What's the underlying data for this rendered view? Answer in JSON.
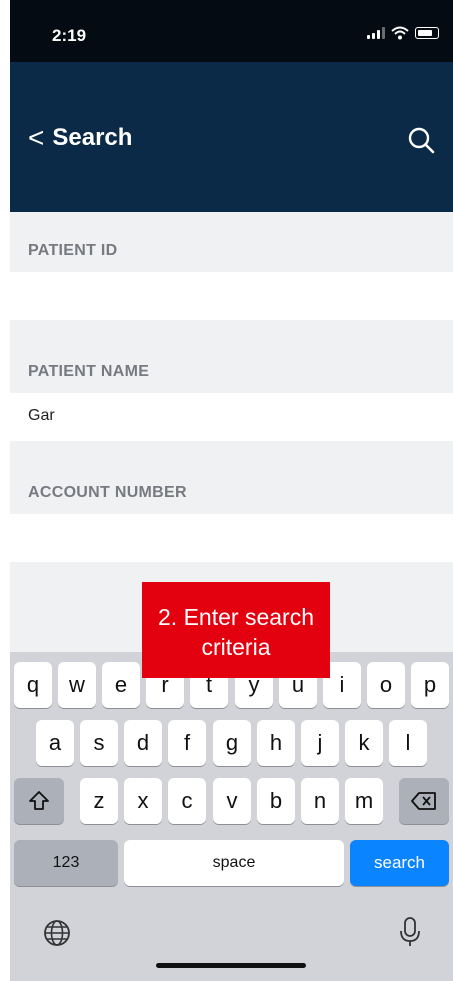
{
  "status_bar": {
    "time": "2:19"
  },
  "nav": {
    "back_label": "Search",
    "back_chevron": "<"
  },
  "form": {
    "patient_id": {
      "label": "PATIENT ID",
      "value": ""
    },
    "patient_name": {
      "label": "PATIENT NAME",
      "value": "Gar"
    },
    "account_number": {
      "label": "ACCOUNT NUMBER",
      "value": ""
    }
  },
  "hint": {
    "line1": "2. Enter search",
    "line2": "criteria"
  },
  "keyboard": {
    "row1": [
      "q",
      "w",
      "e",
      "r",
      "t",
      "y",
      "u",
      "i",
      "o",
      "p"
    ],
    "row2": [
      "a",
      "s",
      "d",
      "f",
      "g",
      "h",
      "j",
      "k",
      "l"
    ],
    "row3": [
      "z",
      "x",
      "c",
      "v",
      "b",
      "n",
      "m"
    ],
    "numbers_label": "123",
    "space_label": "space",
    "search_label": "search"
  },
  "colors": {
    "nav": "#0b2a47",
    "hint": "#e3000f",
    "search_key": "#0a84ff"
  },
  "icons": [
    "signal-icon",
    "wifi-icon",
    "battery-icon",
    "back-chevron-icon",
    "search-icon",
    "shift-icon",
    "delete-icon",
    "globe-icon",
    "microphone-icon"
  ]
}
